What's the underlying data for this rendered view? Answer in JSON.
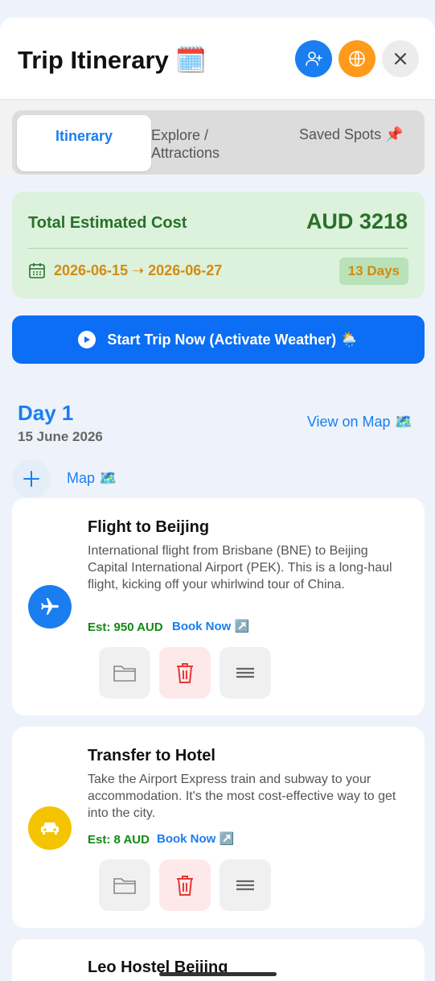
{
  "header": {
    "title": "Trip Itinerary 🗓️",
    "buttons": [
      {
        "icon": "add-person-icon",
        "color": "#1a7ef0"
      },
      {
        "icon": "globe-icon",
        "color": "#ff9a1a"
      },
      {
        "icon": "close-icon",
        "color": "#ececec"
      }
    ]
  },
  "tabs": [
    {
      "label": "Itinerary",
      "active": true
    },
    {
      "label": "Explore / Attractions",
      "active": false
    },
    {
      "label": "Saved Spots 📌",
      "active": false
    }
  ],
  "summary": {
    "cost_label": "Total Estimated Cost",
    "cost_value": "AUD 3218",
    "dates": "2026-06-15 ➝ 2026-06-27",
    "days": "13 Days"
  },
  "start_button": {
    "label": "Start Trip Now (Activate Weather) 🌦️"
  },
  "day": {
    "title": "Day 1",
    "date": "15 June 2026",
    "view_on_map": "View on Map 🗺️",
    "map_link": "Map 🗺️"
  },
  "items": [
    {
      "title": "Flight to Beijing",
      "description": "International flight from Brisbane (BNE) to Beijing Capital International Airport (PEK). This is a long-haul flight, kicking off your whirlwind tour of China.",
      "est": "Est: 950 AUD",
      "book": "Book Now ↗️",
      "icon": "airplane-icon",
      "icon_color": "#1a7ef0"
    },
    {
      "title": "Transfer to Hotel",
      "description": "Take the Airport Express train and subway to your accommodation. It's the most cost-effective way to get into the city.",
      "est": "Est: 8 AUD",
      "book": "Book Now ↗️",
      "icon": "car-icon",
      "icon_color": "#f5c400"
    },
    {
      "title": "Leo Hostel Beijing"
    }
  ],
  "colors": {
    "accent": "#1a7ef0",
    "cost_green": "#2a6f2a",
    "date_orange": "#d48a10",
    "delete_red": "#e53935"
  }
}
